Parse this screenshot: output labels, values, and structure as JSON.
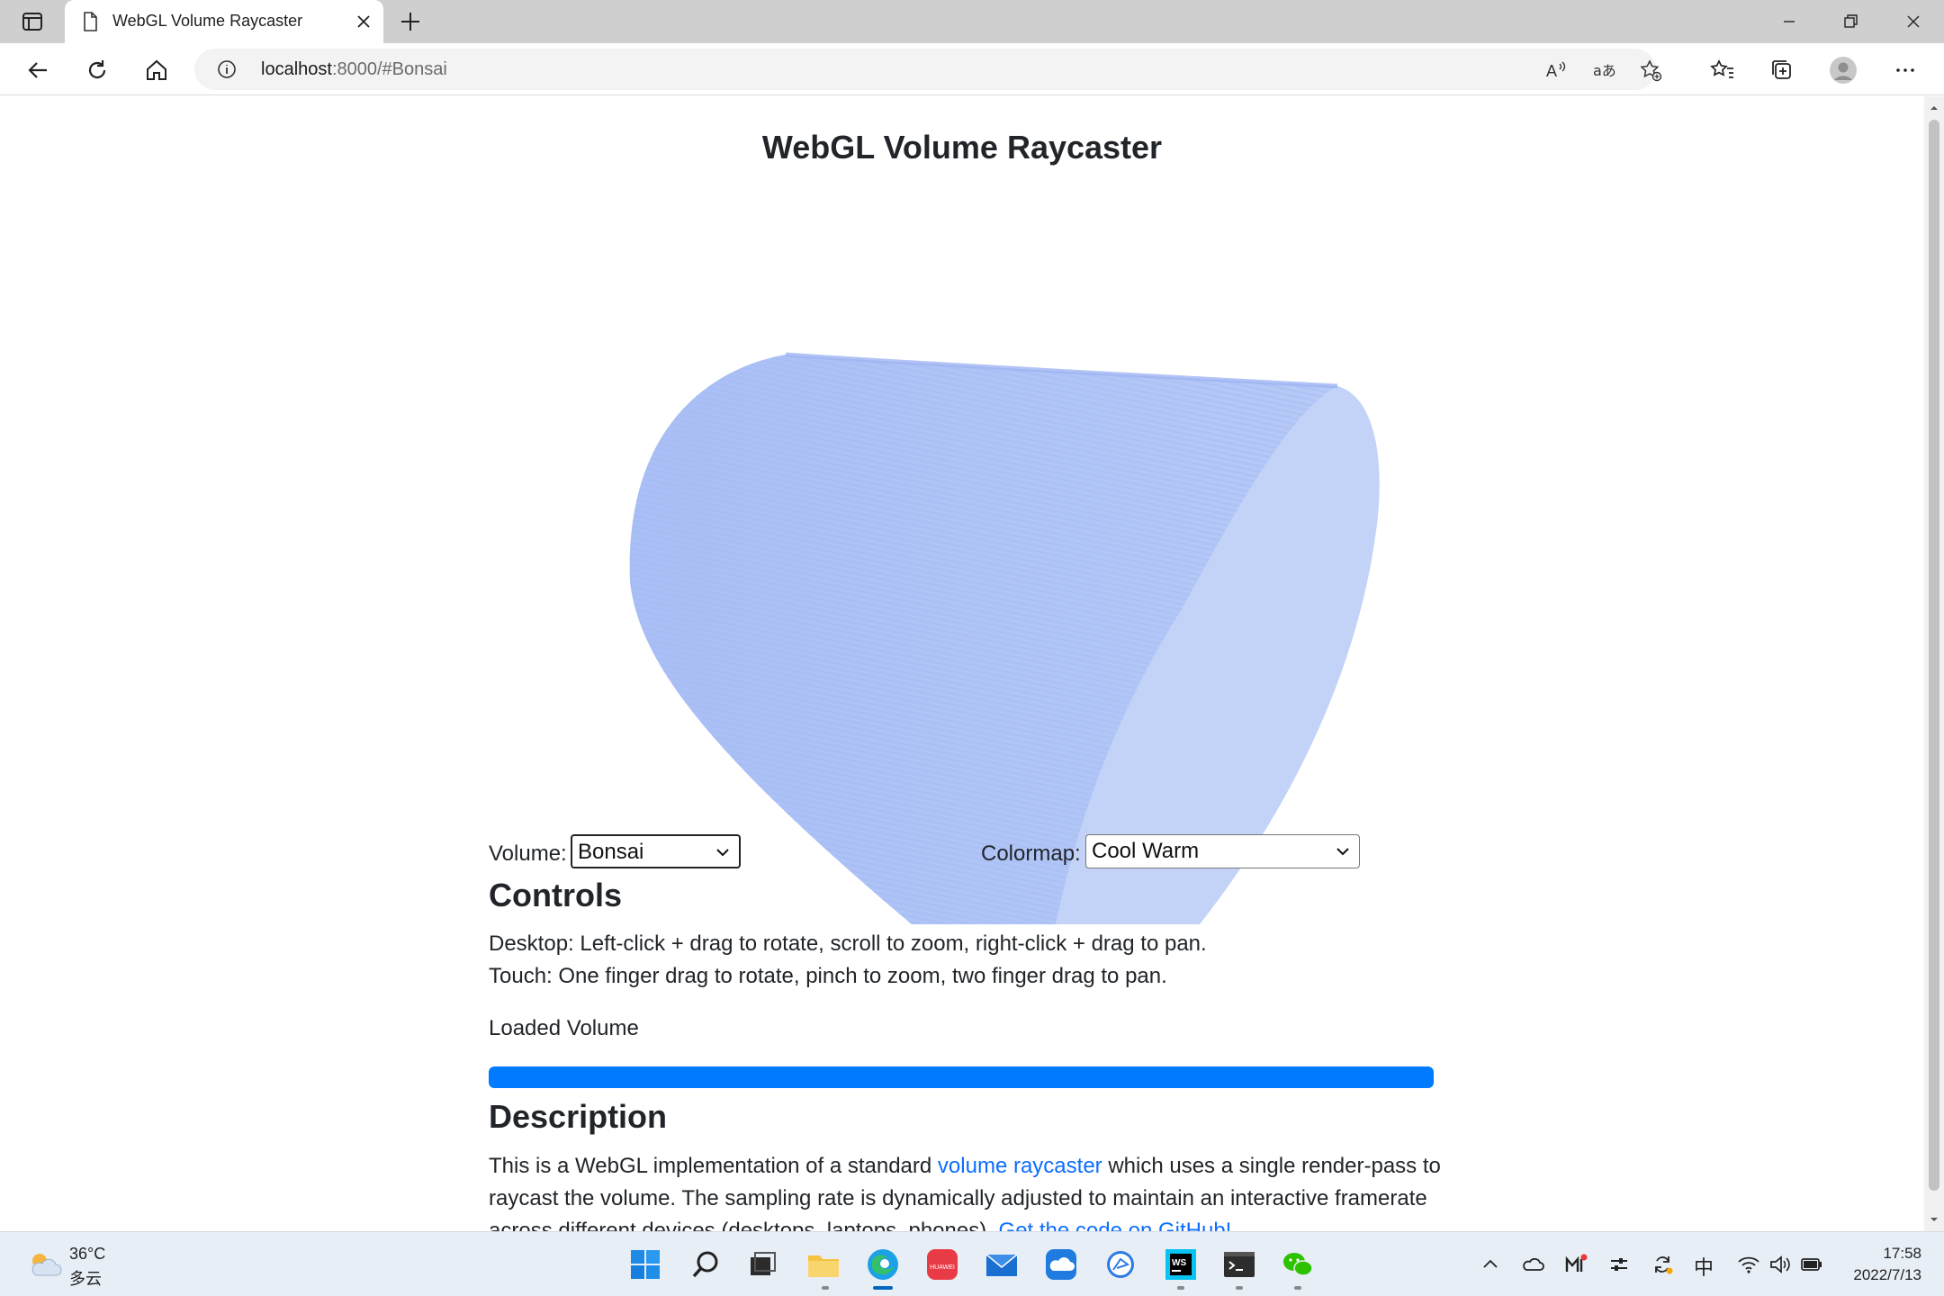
{
  "browser": {
    "tab_title": "WebGL Volume Raycaster",
    "url_host": "localhost",
    "url_rest": ":8000/#Bonsai"
  },
  "page": {
    "title": "WebGL Volume Raycaster",
    "volume_label": "Volume:",
    "volume_value": "Bonsai",
    "colormap_label": "Colormap:",
    "colormap_value": "Cool Warm",
    "controls_heading": "Controls",
    "controls_desktop": "Desktop: Left-click + drag to rotate, scroll to zoom, right-click + drag to pan.",
    "controls_touch": "Touch: One finger drag to rotate, pinch to zoom, two finger drag to pan.",
    "load_status": "Loaded Volume",
    "load_progress": 1.0,
    "description_heading": "Description",
    "desc_part1": "This is a WebGL implementation of a standard ",
    "desc_link1": "volume raycaster",
    "desc_part2": " which uses a single render-pass to raycast the volume. The sampling rate is dynamically adjusted to maintain an interactive framerate across different devices (desktops, laptops, phones). ",
    "desc_link2": "Get the code on GitHub!",
    "render_color": "#b4c8f6"
  },
  "taskbar": {
    "weather_temp": "36°C",
    "weather_desc": "多云",
    "time": "17:58",
    "date": "2022/7/13",
    "ime": "中"
  },
  "colors": {
    "accent": "#0d6efd",
    "progress": "#007bff",
    "volume_fill": "#b4c8f6"
  }
}
